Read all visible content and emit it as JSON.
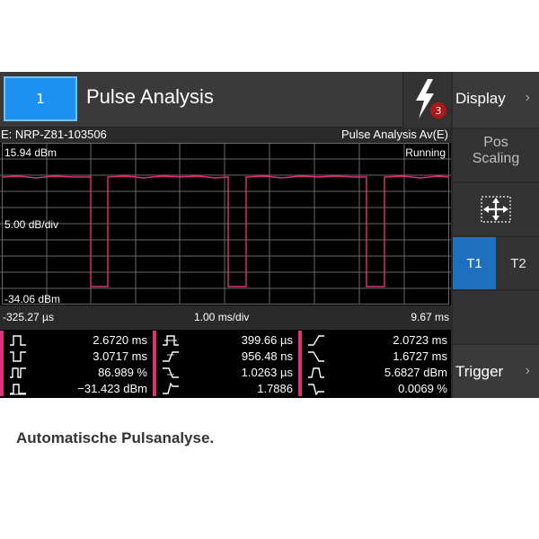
{
  "header": {
    "channel_label": "1",
    "title": "Pulse Analysis",
    "notification_count": "3"
  },
  "sidebar": {
    "display_label": "Display",
    "pos_line1": "Pos",
    "pos_line2": "Scaling",
    "t1_label": "T1",
    "t2_label": "T2",
    "trigger_label": "Trigger"
  },
  "measurement": {
    "sensor": "E: NRP-Z81-103506",
    "mode": "Pulse Analysis Av(E)",
    "ref_level": "15.94 dBm",
    "status": "Running",
    "scale": "5.00 dB/div",
    "bottom_level": "-34.06 dBm",
    "time_start": "-325.27 µs",
    "time_per_div": "1.00 ms/div",
    "time_end": "9.67 ms"
  },
  "results": {
    "col1": [
      "2.6720 ms",
      "3.0717 ms",
      "86.989 %",
      "−31.423 dBm"
    ],
    "col2": [
      "399.66 µs",
      "956.48 ns",
      "1.0263 µs",
      "1.7886"
    ],
    "col3": [
      "2.0723 ms",
      "1.6727 ms",
      "5.6827 dBm",
      "0.0069 %"
    ]
  },
  "caption": "Automatische Pulsanalyse.",
  "colors": {
    "accent": "#1e90f0",
    "trace": "#e0307a",
    "badge": "#b01818"
  }
}
